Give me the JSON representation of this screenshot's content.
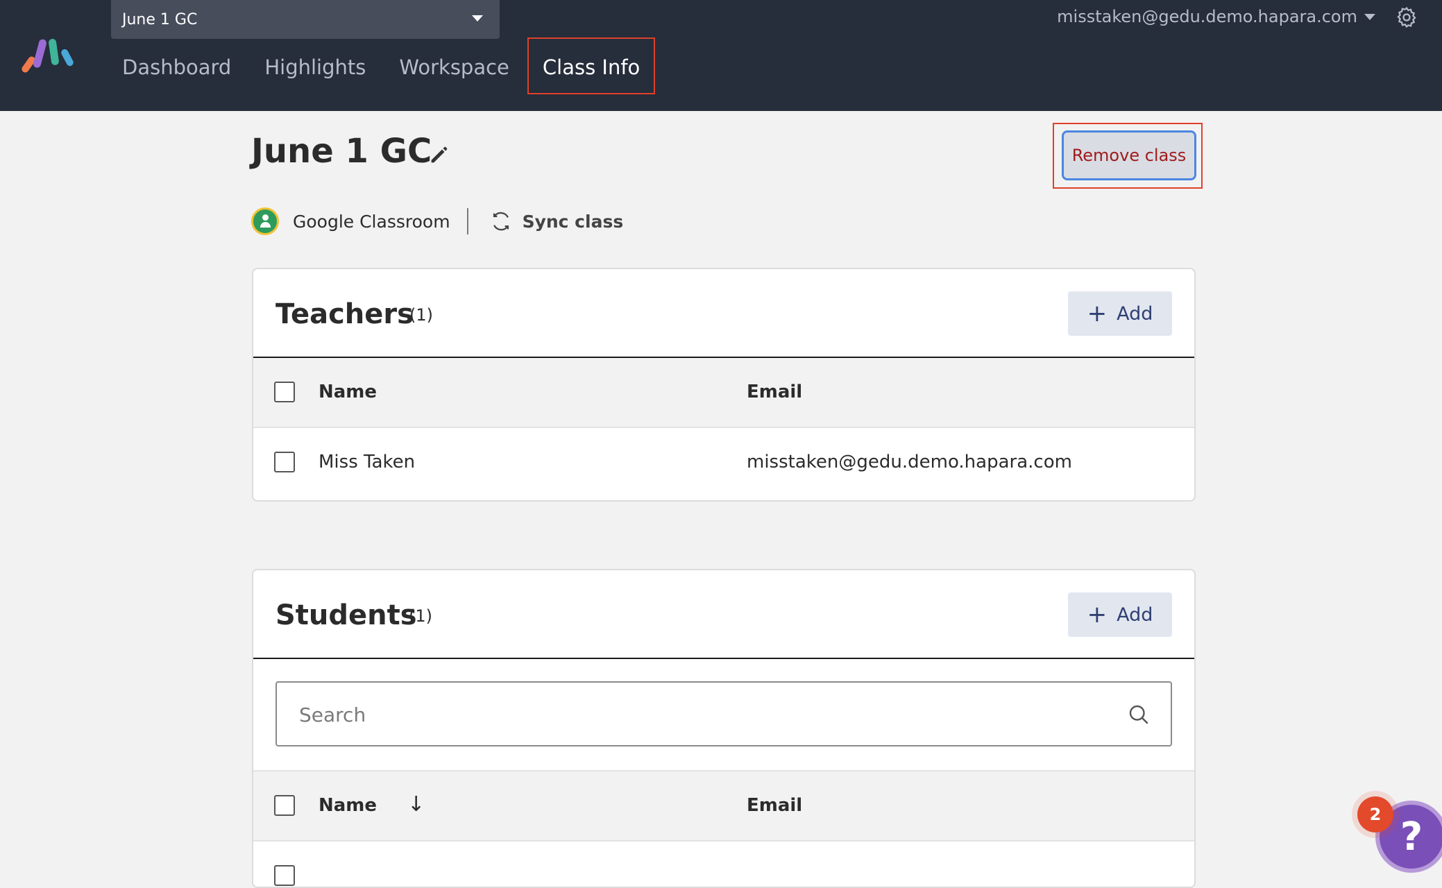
{
  "header": {
    "class_selector": "June 1 GC",
    "nav": [
      "Dashboard",
      "Highlights",
      "Workspace",
      "Class Info"
    ],
    "active_nav": "Class Info",
    "account_email": "misstaken@gedu.demo.hapara.com",
    "logo_icon": "hapara-logo",
    "settings_icon": "gear-icon"
  },
  "page": {
    "title": "June 1 GC",
    "remove_class_label": "Remove class",
    "provider_label": "Google Classroom",
    "sync_label": "Sync class"
  },
  "teachers": {
    "title": "Teachers",
    "count": "(1)",
    "add_label": "Add",
    "columns": {
      "name": "Name",
      "email": "Email"
    },
    "rows": [
      {
        "name": "Miss Taken",
        "email": "misstaken@gedu.demo.hapara.com"
      }
    ]
  },
  "students": {
    "title": "Students",
    "count": "(1)",
    "add_label": "Add",
    "search_placeholder": "Search",
    "columns": {
      "name": "Name",
      "email": "Email",
      "sort_indicator": "↓"
    }
  },
  "help": {
    "badge_count": "2",
    "icon": "?"
  },
  "colors": {
    "header_bg": "#262d3b",
    "highlight_outline": "#e0402b",
    "remove_text": "#a01b1b",
    "add_button_bg": "#e2e6ef",
    "help_purple": "#7a4fb8"
  }
}
